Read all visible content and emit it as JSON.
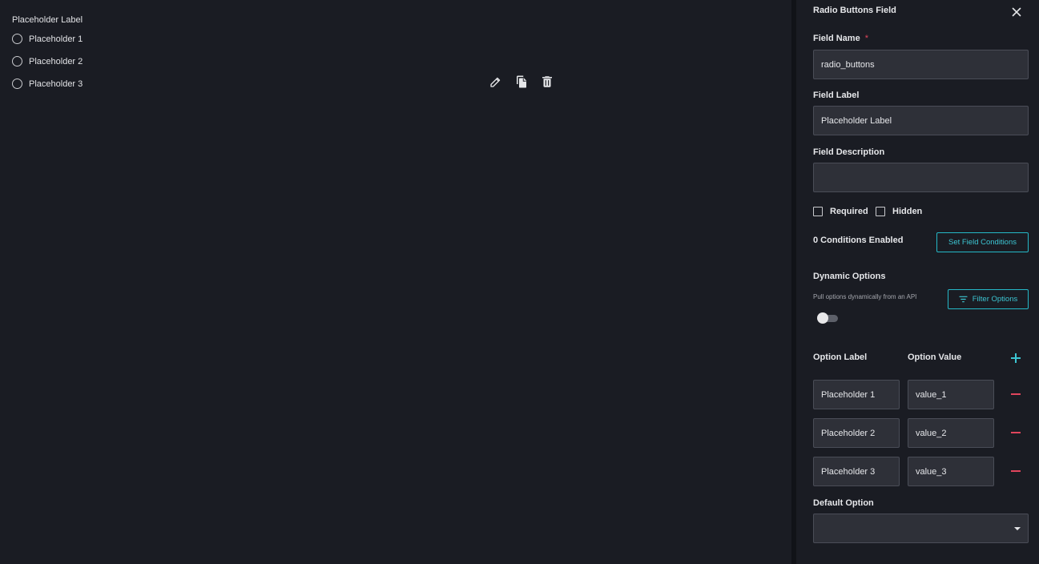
{
  "preview": {
    "label": "Placeholder Label",
    "options": [
      "Placeholder 1",
      "Placeholder 2",
      "Placeholder 3"
    ],
    "tools": [
      "pencil-icon",
      "copy-icon",
      "trash-icon"
    ]
  },
  "panel": {
    "title": "Radio Buttons Field",
    "field_name": {
      "label": "Field Name",
      "required_mark": "*",
      "value": "radio_buttons"
    },
    "field_label": {
      "label": "Field Label",
      "value": "Placeholder Label"
    },
    "field_description": {
      "label": "Field Description",
      "value": ""
    },
    "required": {
      "label": "Required",
      "checked": false
    },
    "hidden": {
      "label": "Hidden",
      "checked": false
    },
    "conditions": {
      "text": "0 Conditions Enabled",
      "button": "Set Field Conditions"
    },
    "dynamic": {
      "title": "Dynamic Options",
      "note": "Pull options dynamically from an API",
      "filter_button": "Filter Options",
      "enabled": false
    },
    "options_header": {
      "label": "Option Label",
      "value": "Option Value"
    },
    "options": [
      {
        "label": "Placeholder 1",
        "value": "value_1"
      },
      {
        "label": "Placeholder 2",
        "value": "value_2"
      },
      {
        "label": "Placeholder 3",
        "value": "value_3"
      }
    ],
    "default_option": {
      "label": "Default Option",
      "value": ""
    }
  },
  "colors": {
    "background": "#1a1c23",
    "input_bg": "#2e3038",
    "accent": "#25b8c7",
    "danger": "#e0455c"
  }
}
